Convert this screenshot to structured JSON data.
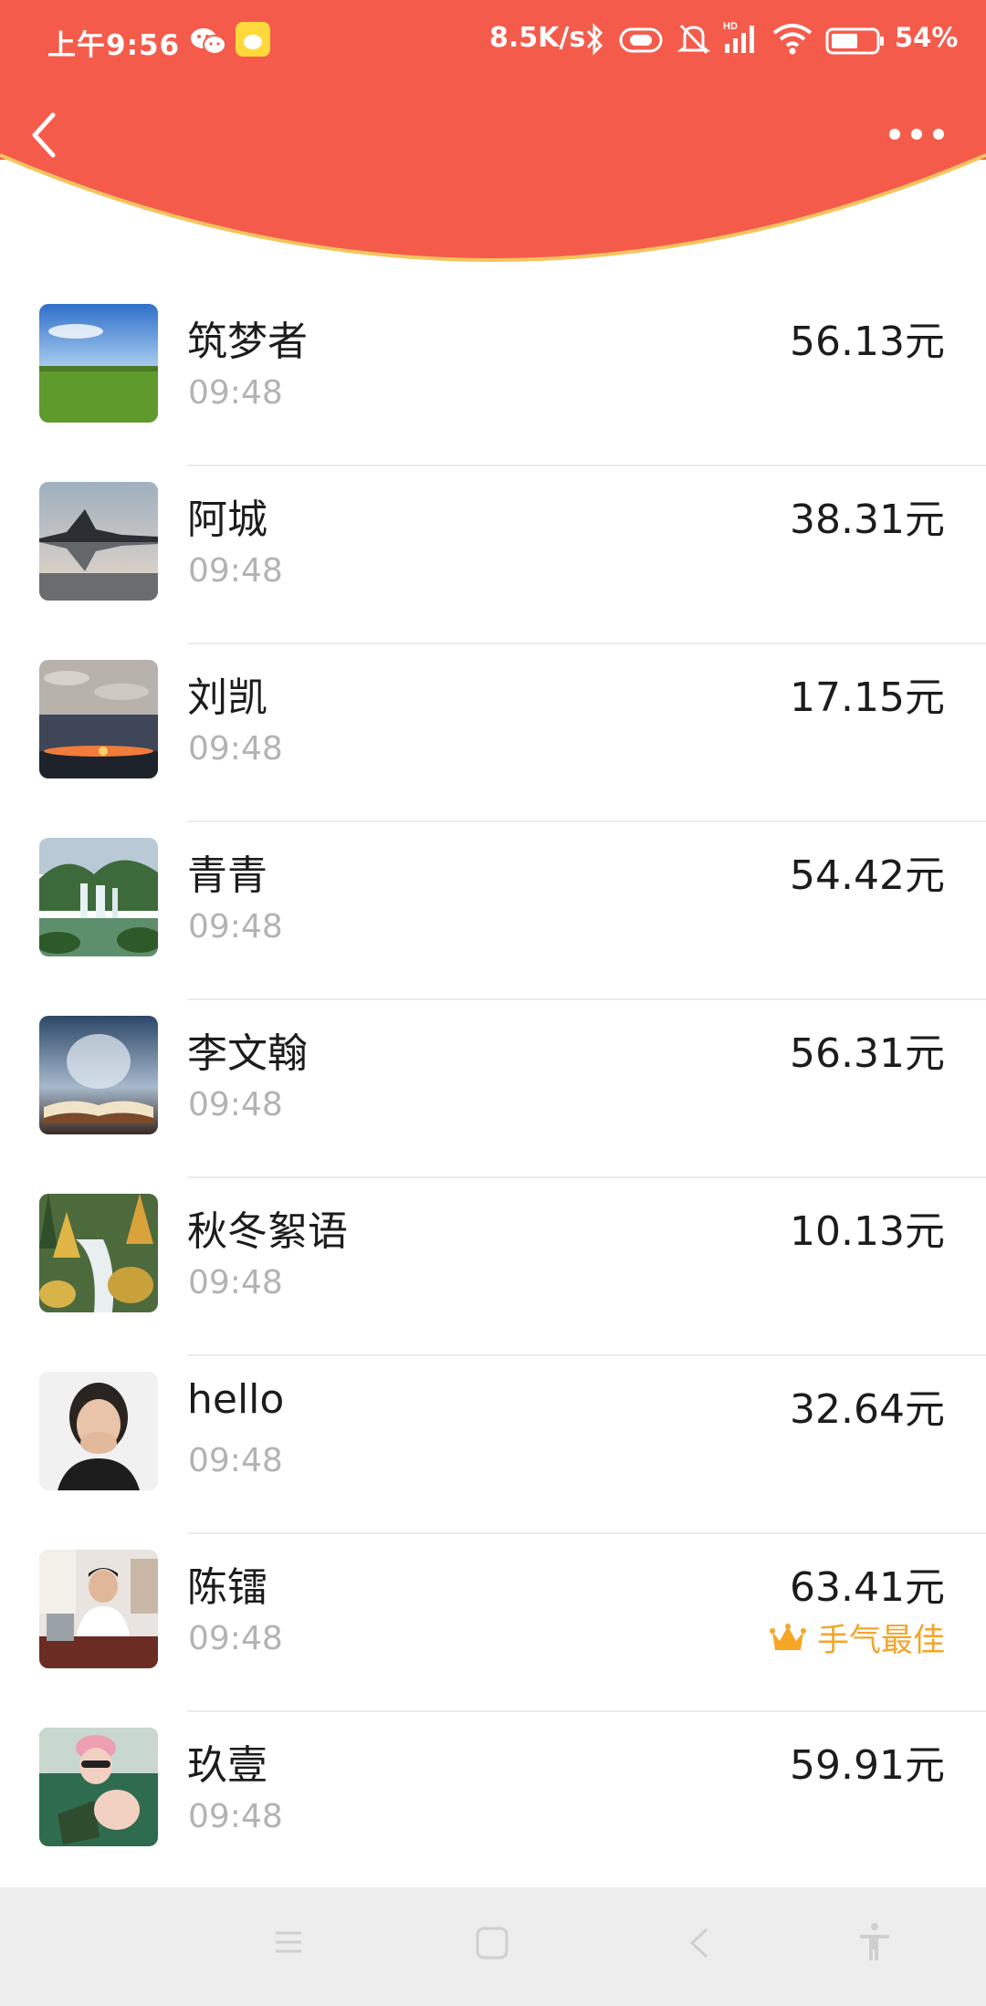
{
  "status_bar": {
    "time": "上午9:56",
    "net_speed": "8.5K/s",
    "battery_percent": "54%",
    "icons": [
      "wechat-icon",
      "app-notification-icon",
      "bluetooth-icon",
      "vibrate-icon",
      "mute-bell-icon",
      "hd-signal-icon",
      "wifi-icon",
      "battery-icon"
    ]
  },
  "header": {
    "background_color": "#f55b4b",
    "accent_border_color": "#f4c45e",
    "back_icon": "chevron-left-icon",
    "more_icon": "more-dots-icon"
  },
  "list": {
    "items": [
      {
        "name": "筑梦者",
        "time": "09:48",
        "amount": "56.13元",
        "avatar": "meadow-sky"
      },
      {
        "name": "阿城",
        "time": "09:48",
        "amount": "38.31元",
        "avatar": "lake-reflection"
      },
      {
        "name": "刘凯",
        "time": "09:48",
        "amount": "17.15元",
        "avatar": "sunset-clouds"
      },
      {
        "name": "青青",
        "time": "09:48",
        "amount": "54.42元",
        "avatar": "waterfall-green"
      },
      {
        "name": "李文翰",
        "time": "09:48",
        "amount": "56.31元",
        "avatar": "open-book"
      },
      {
        "name": "秋冬絮语",
        "time": "09:48",
        "amount": "10.13元",
        "avatar": "autumn-stream"
      },
      {
        "name": "hello",
        "time": "09:48",
        "amount": "32.64元",
        "avatar": "woman-portrait"
      },
      {
        "name": "陈镭",
        "time": "09:48",
        "amount": "63.41元",
        "avatar": "man-at-desk",
        "best_label": "手气最佳"
      },
      {
        "name": "玖壹",
        "time": "09:48",
        "amount": "59.91元",
        "avatar": "reading-woman"
      }
    ],
    "best_color": "#f3a52b"
  },
  "nav_bar": {
    "icons": [
      "menu-icon",
      "home-square-icon",
      "back-triangle-icon",
      "accessibility-icon"
    ]
  }
}
